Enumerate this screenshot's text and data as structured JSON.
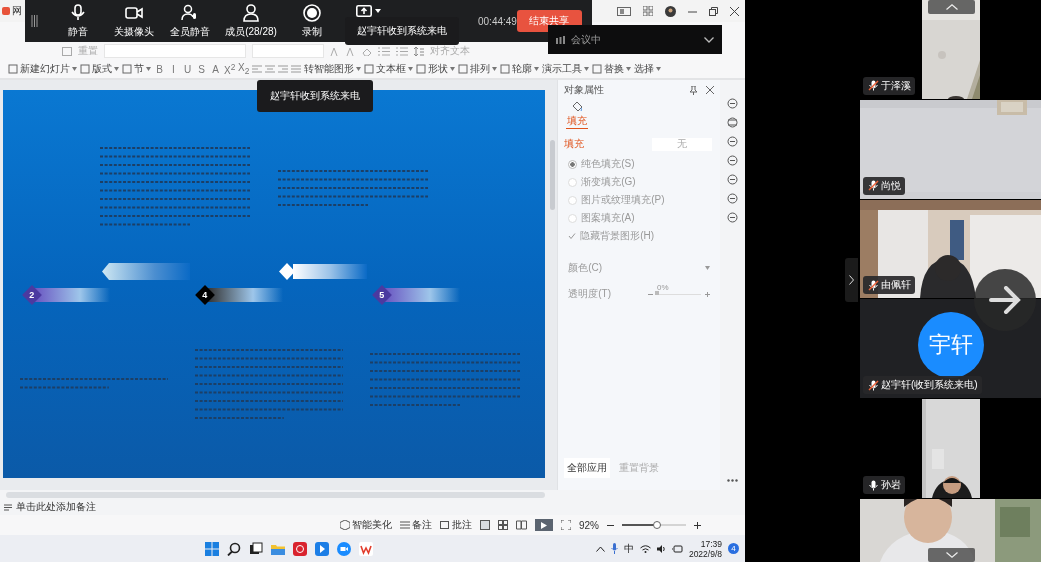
{
  "window": {
    "title": "网"
  },
  "meeting_toolbar": {
    "buttons": [
      {
        "kind": "mic",
        "label": "静音"
      },
      {
        "kind": "camera",
        "label": "关摄像头"
      },
      {
        "kind": "mute-all",
        "label": "全员静音"
      },
      {
        "kind": "members",
        "label": "成员(28/28)"
      },
      {
        "kind": "record",
        "label": "录制"
      },
      {
        "kind": "share"
      }
    ],
    "timer": "00:44:49",
    "end_button": "结束共享"
  },
  "toasts": [
    "赵宇轩收到系统来电",
    "赵宇轩收到系统来电"
  ],
  "meeting_status": "会议中",
  "ribbon": {
    "row1": [
      "重置",
      "对齐文本"
    ],
    "format_buttons": [
      "B",
      "I",
      "U",
      "S",
      "A",
      "X$^{2}$",
      "X$_{2}$"
    ],
    "row2": [
      {
        "label": "新建幻灯片"
      },
      {
        "label": "版式"
      },
      {
        "label": "节"
      },
      {
        "label": "转智能图形"
      },
      {
        "label": "文本框"
      },
      {
        "label": "形状"
      },
      {
        "label": "排列"
      },
      {
        "label": "轮廓"
      },
      {
        "label": "演示工具"
      },
      {
        "label": "替换"
      },
      {
        "label": "选择"
      }
    ]
  },
  "slide": {
    "markers": [
      "2",
      "4",
      "5"
    ]
  },
  "properties": {
    "title": "对象属性",
    "tab": "填充",
    "section": "填充",
    "fill_value": "无",
    "options": [
      {
        "kind": "radio",
        "label": "纯色填充(S)",
        "selected": true
      },
      {
        "kind": "radio",
        "label": "渐变填充(G)",
        "selected": false
      },
      {
        "kind": "radio",
        "label": "图片或纹理填充(P)",
        "selected": false
      },
      {
        "kind": "radio",
        "label": "图案填充(A)",
        "selected": false
      },
      {
        "kind": "checkbox",
        "label": "隐藏背景图形(H)",
        "checked": true
      }
    ],
    "color_label": "颜色(C)",
    "transparency_label": "透明度(T)",
    "transparency": {
      "value": "0%",
      "level": 0
    },
    "buttons": [
      "全部应用",
      "重置背景"
    ]
  },
  "notes": {
    "placeholder": "单击此处添加备注"
  },
  "status_bar": {
    "beautify": "智能美化",
    "notes": "备注",
    "comments": "批注",
    "zoom": "92%",
    "zoom_slider": {
      "level": 0.55
    }
  },
  "taskbar": {
    "ime": "中",
    "time": "17:39",
    "date": "2022/9/8",
    "badge": "4"
  },
  "participants": [
    {
      "kind": "portrait",
      "name": "于泽溪",
      "muted": true
    },
    {
      "kind": "landscape",
      "name": "尚悦",
      "muted": true
    },
    {
      "kind": "landscape",
      "name": "由佩轩",
      "muted": true
    },
    {
      "kind": "avatar",
      "avatar": "宇轩",
      "name": "赵宇轩(收到系统来电)",
      "muted": true
    },
    {
      "kind": "portrait",
      "name": "孙岩",
      "muted": false
    },
    {
      "kind": "landscape"
    }
  ]
}
